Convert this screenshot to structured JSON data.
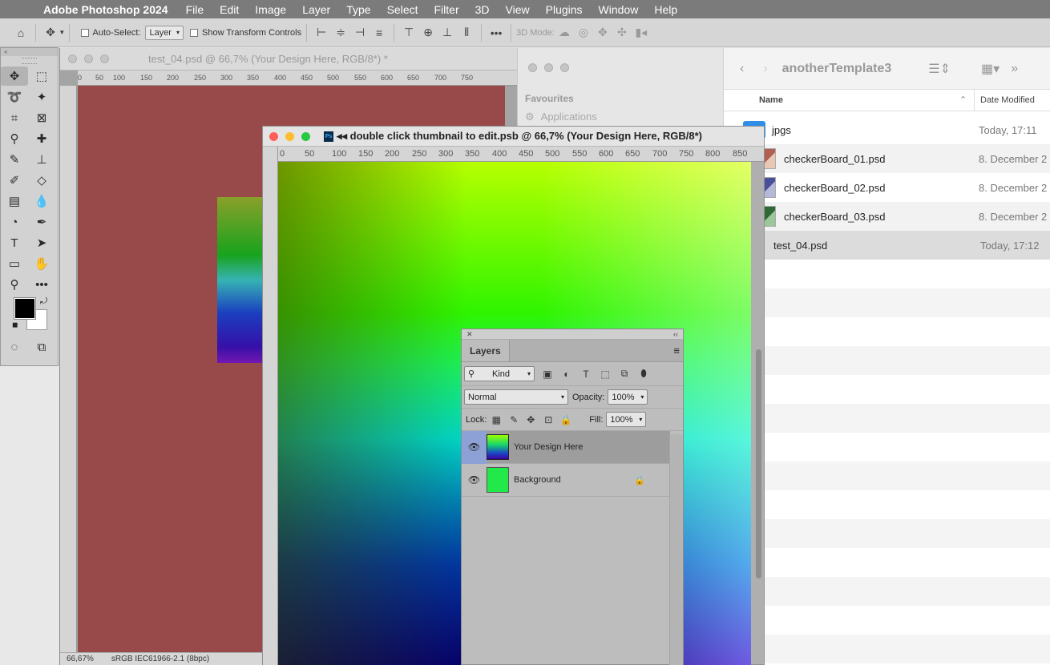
{
  "menubar": {
    "app_name": "Adobe Photoshop 2024",
    "items": [
      "File",
      "Edit",
      "Image",
      "Layer",
      "Type",
      "Select",
      "Filter",
      "3D",
      "View",
      "Plugins",
      "Window",
      "Help"
    ]
  },
  "options": {
    "auto_select_label": "Auto-Select:",
    "auto_select_value": "Layer",
    "transform_controls_label": "Show Transform Controls",
    "mode_3d_label": "3D Mode:"
  },
  "doc_back": {
    "title": "test_04.psd @ 66,7% (Your Design Here, RGB/8*) *",
    "zoom": "66,67%",
    "profile": "sRGB IEC61966-2.1 (8bpc)",
    "ruler_ticks": [
      "0",
      "50",
      "100",
      "150",
      "200",
      "250",
      "300",
      "350",
      "400",
      "450",
      "500",
      "550",
      "600",
      "650",
      "700",
      "750"
    ]
  },
  "doc_front": {
    "title": "◂◂ double click thumbnail to edit.psb @ 66,7% (Your Design Here, RGB/8*)",
    "ruler_ticks": [
      "0",
      "50",
      "100",
      "150",
      "200",
      "250",
      "300",
      "350",
      "400",
      "450",
      "500",
      "550",
      "600",
      "650",
      "700",
      "750",
      "800",
      "850"
    ],
    "ps_badge": "Ps"
  },
  "finder": {
    "sidebar_heading": "Favourites",
    "sidebar_item": "Applications",
    "folder_title": "anotherTemplate3",
    "col_name": "Name",
    "col_date": "Date Modified",
    "rows": [
      {
        "name": "jpgs",
        "date": "Today, 17:11"
      },
      {
        "name": "checkerBoard_01.psd",
        "date": "8. December 2"
      },
      {
        "name": "checkerBoard_02.psd",
        "date": "8. December 2"
      },
      {
        "name": "checkerBoard_03.psd",
        "date": "8. December 2"
      },
      {
        "name": "test_04.psd",
        "date": "Today, 17:12"
      }
    ]
  },
  "layers_panel": {
    "tab": "Layers",
    "filter_kind": "Kind",
    "blend_mode": "Normal",
    "opacity_label": "Opacity:",
    "opacity_value": "100%",
    "lock_label": "Lock:",
    "fill_label": "Fill:",
    "fill_value": "100%",
    "layers": [
      {
        "name": "Your Design Here",
        "selected": true
      },
      {
        "name": "Background",
        "selected": false
      }
    ]
  },
  "colors": {
    "foreground": "#000000",
    "background": "#ffffff",
    "canvas_back": "#984a4b"
  }
}
